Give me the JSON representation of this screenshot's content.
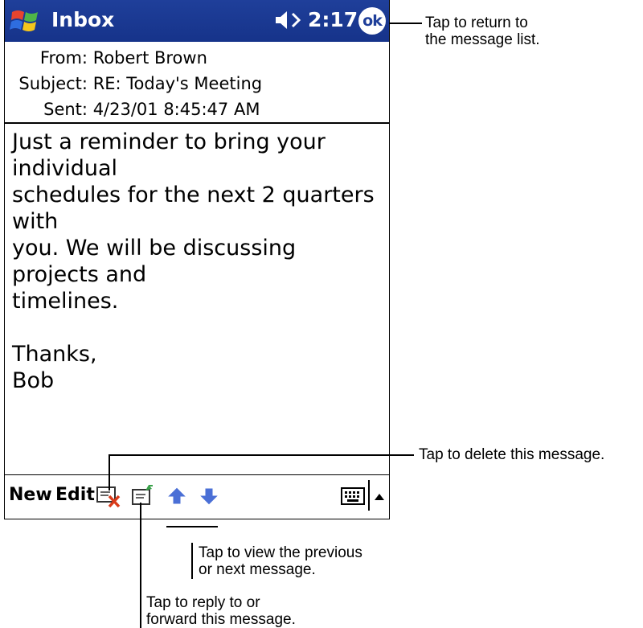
{
  "titlebar": {
    "app_title": "Inbox",
    "clock": "2:17",
    "ok_label": "ok"
  },
  "header": {
    "from_label": "From:",
    "from_value": "Robert Brown",
    "subject_label": "Subject:",
    "subject_value": "RE: Today's Meeting",
    "sent_label": "Sent:",
    "sent_value": "4/23/01 8:45:47 AM"
  },
  "message_body": "Just a reminder to bring your individual\nschedules for the next 2 quarters with\nyou. We will be discussing projects and\ntimelines.\n\nThanks,\nBob",
  "toolbar": {
    "new_label": "New",
    "edit_label": "Edit"
  },
  "callouts": {
    "ok": "Tap to return to\nthe message list.",
    "delete": "Tap to delete this message.",
    "prev_next": "Tap to view  the previous\nor next message.",
    "reply": "Tap to reply to or\nforward this message."
  },
  "colors": {
    "titlebar": "#1f3f9a",
    "arrow_blue": "#4a6fd6",
    "delete_red": "#d93b1a"
  },
  "icons": {
    "start": "windows-flag-icon",
    "speaker": "speaker-icon",
    "delete": "delete-icon",
    "reply": "reply-forward-icon",
    "previous": "up-arrow-icon",
    "next": "down-arrow-icon",
    "keyboard": "keyboard-icon",
    "sip": "sip-toggle-icon"
  }
}
